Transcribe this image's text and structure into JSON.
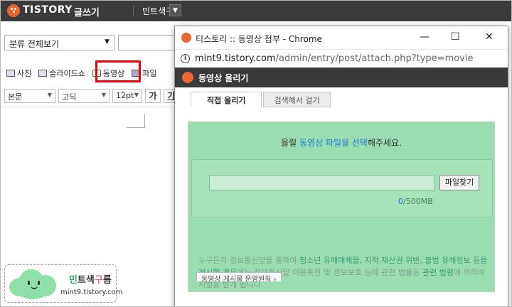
{
  "app": {
    "brand": "TISTORY",
    "brand_sub": "글쓰기",
    "blog_name": "민트색구름",
    "blog_drop_icon": "chevron-down-icon"
  },
  "editor": {
    "category": "분류 전체보기",
    "toolbar1": [
      {
        "label": "사진",
        "icon": "photo-icon"
      },
      {
        "label": "슬라이드쇼",
        "icon": "slideshow-icon"
      },
      {
        "label": "동영상",
        "icon": "video-icon"
      },
      {
        "label": "파일",
        "icon": "file-icon"
      }
    ],
    "format": {
      "style": "본문",
      "font": "고딕",
      "size": "12pt",
      "bold": "가",
      "italic": "가"
    }
  },
  "watermark": {
    "name_1": "민",
    "name_2": "트색",
    "name_3": "구",
    "name_4": "름",
    "url": "mint9.tistory.com"
  },
  "popup": {
    "window_title": "티스토리 :: 동영상 첨부 - Chrome",
    "controls": {
      "minimize": "—",
      "maximize": "☐",
      "close": "✕"
    },
    "url_host": "mint9.tistory.com",
    "url_path": "/admin/entry/post/attach.php?type=movie",
    "header_title": "동영상 올리기",
    "tabs": [
      "직접 올리기",
      "검색해서 걸기"
    ],
    "prompt_before": "올릴 ",
    "prompt_accent": "동영상 파일을 선택",
    "prompt_after": "해주세요.",
    "file_button": "파일찾기",
    "progress_current": "0",
    "progress_total": "/500MB",
    "notice_1": "누구든지 정보통신망을 통하여 ",
    "notice_hl1": "청소년 유해매체물, 지적 재산권 위반, 불법 유해정보 등을 게시할 경우",
    "notice_2": "에는 정보통신망 이용촉진 및 정보보호 등에 관한 법률등 ",
    "notice_hl2": "관련 법령",
    "notice_3": "에 의하여 처벌을 받게 됩니다.",
    "footer_button": "동영상 게시물 운영원칙 ›"
  }
}
